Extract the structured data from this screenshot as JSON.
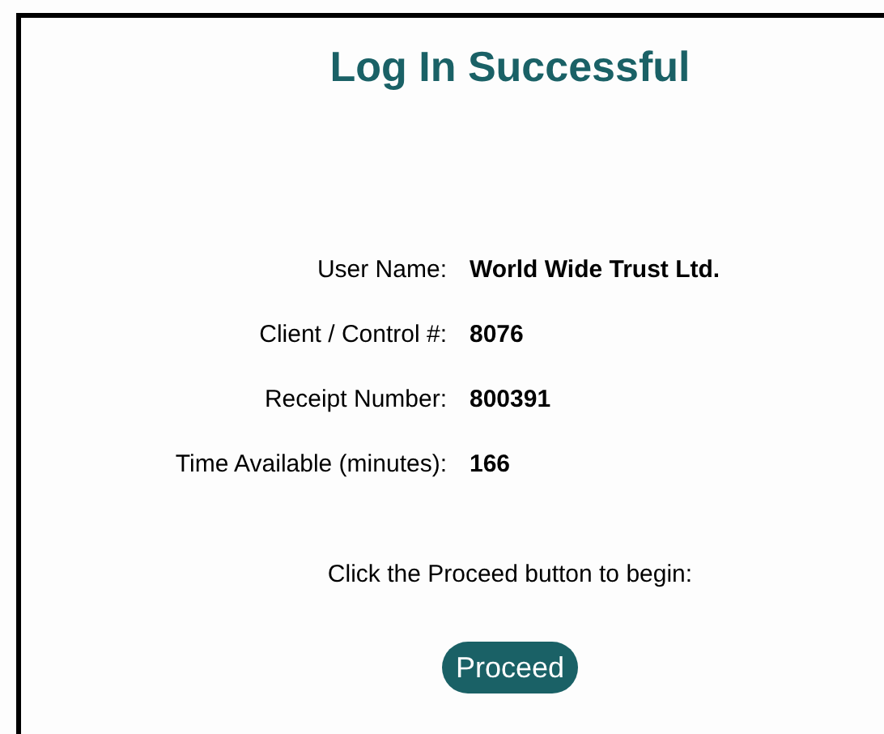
{
  "title": "Log In Successful",
  "fields": [
    {
      "label": "User Name:",
      "value": "World Wide Trust Ltd."
    },
    {
      "label": "Client / Control #:",
      "value": "8076"
    },
    {
      "label": "Receipt Number:",
      "value": "800391"
    },
    {
      "label": "Time Available (minutes):",
      "value": "166"
    }
  ],
  "instruction": "Click the Proceed button to begin:",
  "button": "Proceed"
}
